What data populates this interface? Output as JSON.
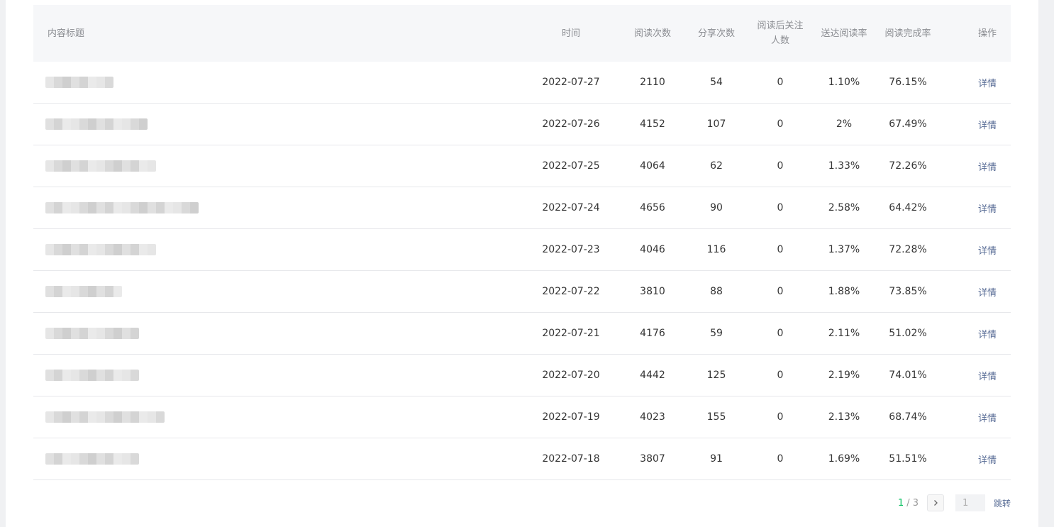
{
  "table": {
    "headers": {
      "title": "内容标题",
      "date": "时间",
      "reads": "阅读次数",
      "shares": "分享次数",
      "follow": "阅读后关注人数",
      "rate": "送达阅读率",
      "complete": "阅读完成率",
      "op": "操作"
    },
    "rows": [
      {
        "date": "2022-07-27",
        "reads": "2110",
        "shares": "54",
        "follow": "0",
        "rate": "1.10%",
        "complete": "76.15%",
        "op": "详情"
      },
      {
        "date": "2022-07-26",
        "reads": "4152",
        "shares": "107",
        "follow": "0",
        "rate": "2%",
        "complete": "67.49%",
        "op": "详情"
      },
      {
        "date": "2022-07-25",
        "reads": "4064",
        "shares": "62",
        "follow": "0",
        "rate": "1.33%",
        "complete": "72.26%",
        "op": "详情"
      },
      {
        "date": "2022-07-24",
        "reads": "4656",
        "shares": "90",
        "follow": "0",
        "rate": "2.58%",
        "complete": "64.42%",
        "op": "详情"
      },
      {
        "date": "2022-07-23",
        "reads": "4046",
        "shares": "116",
        "follow": "0",
        "rate": "1.37%",
        "complete": "72.28%",
        "op": "详情"
      },
      {
        "date": "2022-07-22",
        "reads": "3810",
        "shares": "88",
        "follow": "0",
        "rate": "1.88%",
        "complete": "73.85%",
        "op": "详情"
      },
      {
        "date": "2022-07-21",
        "reads": "4176",
        "shares": "59",
        "follow": "0",
        "rate": "2.11%",
        "complete": "51.02%",
        "op": "详情"
      },
      {
        "date": "2022-07-20",
        "reads": "4442",
        "shares": "125",
        "follow": "0",
        "rate": "2.19%",
        "complete": "74.01%",
        "op": "详情"
      },
      {
        "date": "2022-07-19",
        "reads": "4023",
        "shares": "155",
        "follow": "0",
        "rate": "2.13%",
        "complete": "68.74%",
        "op": "详情"
      },
      {
        "date": "2022-07-18",
        "reads": "3807",
        "shares": "91",
        "follow": "0",
        "rate": "1.69%",
        "complete": "51.51%",
        "op": "详情"
      }
    ]
  },
  "pagination": {
    "current": "1",
    "total": "/ 3",
    "input_value": "1",
    "jump_label": "跳转"
  },
  "colors": {
    "accent": "#07c160",
    "link": "#576b95"
  },
  "icons": {
    "next": "chevron-right-icon"
  }
}
